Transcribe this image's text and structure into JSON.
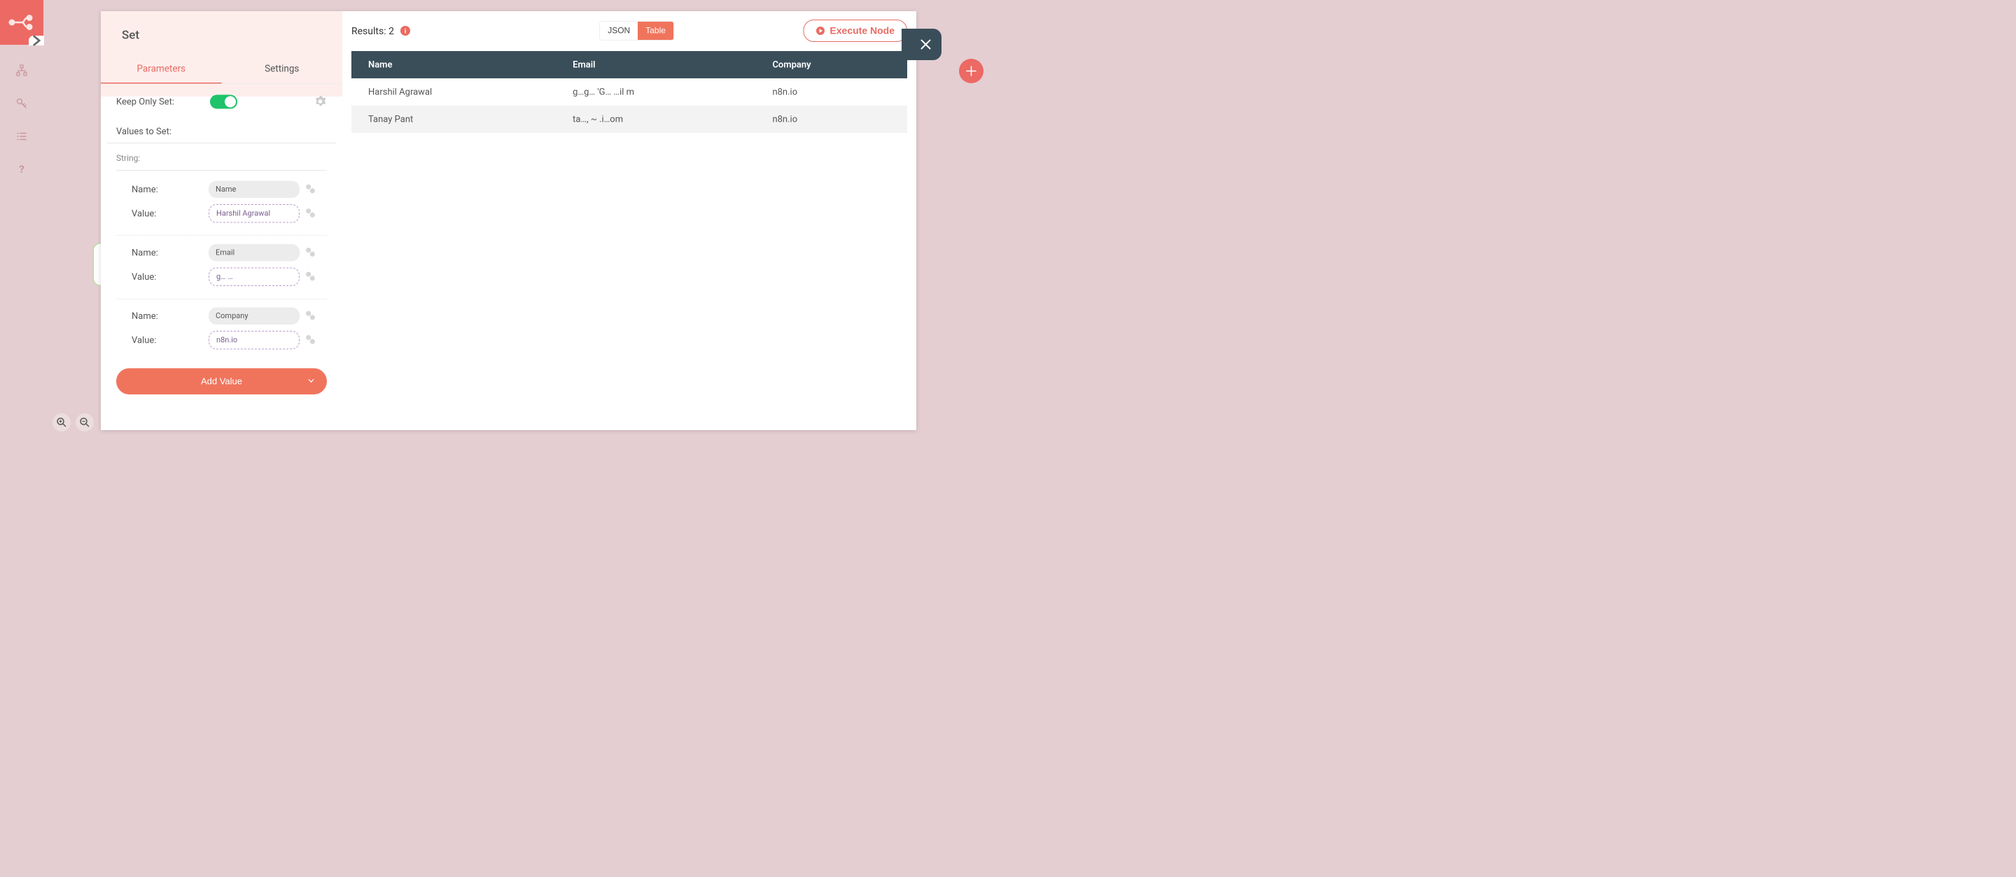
{
  "sidebar": {
    "icons": [
      "workflows-icon",
      "credentials-icon",
      "executions-icon",
      "help-icon"
    ]
  },
  "modal": {
    "title": "Set",
    "tabs": {
      "parameters": "Parameters",
      "settings": "Settings",
      "active": "parameters"
    },
    "form": {
      "keep_only_set_label": "Keep Only Set:",
      "keep_only_set_value": true,
      "values_to_set_label": "Values to Set:",
      "string_section_label": "String:",
      "name_label": "Name:",
      "value_label": "Value:",
      "fields": [
        {
          "name": "Name",
          "value": "Harshil Agrawal",
          "value_is_expression": true
        },
        {
          "name": "Email",
          "value": "g…             …",
          "value_is_expression": true
        },
        {
          "name": "Company",
          "value": "n8n.io",
          "value_is_expression": true
        }
      ],
      "add_value_label": "Add Value"
    }
  },
  "results": {
    "label_prefix": "Results: ",
    "count": 2,
    "view_json_label": "JSON",
    "view_table_label": "Table",
    "view_active": "table",
    "execute_label": "Execute Node",
    "columns": [
      "Name",
      "Email",
      "Company"
    ],
    "rows": [
      {
        "Name": "Harshil Agrawal",
        "Email": "g…g…   'G…  …il  m",
        "Company": "n8n.io"
      },
      {
        "Name": "Tanay Pant",
        "Email": "ta…,    ~    .i…om",
        "Company": "n8n.io"
      }
    ]
  },
  "colors": {
    "accent": "#e96b62",
    "dark": "#3a4e5a",
    "toggle_on": "#1ec36a"
  }
}
